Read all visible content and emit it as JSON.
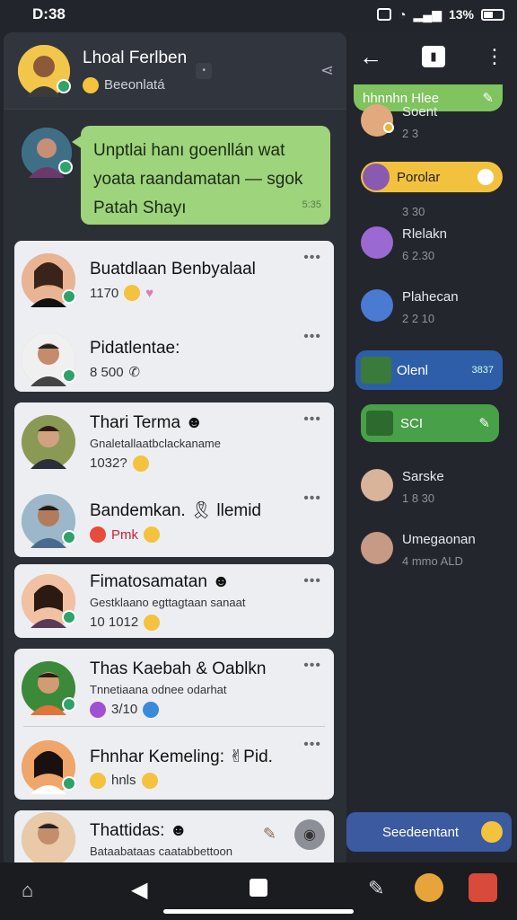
{
  "status_bar": {
    "time": "D:38",
    "battery": "13%"
  },
  "chat_header": {
    "title": "Lhoal Ferlben",
    "subtitle": "Beeonlatá"
  },
  "pinned_message": {
    "lines": [
      "Unptlai hanı goenllán wat",
      "yoata raandamatan — sgok",
      "Patah Shayı"
    ],
    "time": "5:35"
  },
  "chats": [
    {
      "title": "Buatdlaan Benbyalaal",
      "meta": "1170"
    },
    {
      "title": "Pidatlentae:",
      "meta": "8 500"
    },
    {
      "title": "Thari Terma",
      "sub": "Gnaletallaatbclackaname",
      "meta": "1032?"
    },
    {
      "title": "Bandemkan.",
      "title2": "llemid",
      "meta": "Pmk"
    },
    {
      "title": "Fimatosamatan",
      "sub": "Gestklaano egttagtaan sanaat",
      "meta": "10 1012"
    },
    {
      "title": "Thas Kaebah & Oablkn",
      "sub": "Tnnetiaana odnee odarhat",
      "meta": "3/10"
    },
    {
      "title": "Fhnhar Kemeling:",
      "title2": "Pid.",
      "meta": "hnls"
    },
    {
      "title": "Thattidas:",
      "sub": "Bataabataas caatabbettoon"
    }
  ],
  "right_panel": {
    "top_pill": "hhnnhn Hlee",
    "items": [
      {
        "name": "Soent",
        "time": "2 3"
      },
      {
        "name": "Porolar",
        "time": "3 30"
      },
      {
        "name": "Rlelakn",
        "time": "6 2.30"
      },
      {
        "name": "Plahecan",
        "time": "2 2 10"
      },
      {
        "name": "Olenl",
        "time": "3837"
      },
      {
        "name": "SCI",
        "time": ""
      },
      {
        "name": "Sarske",
        "time": "1 8 30"
      },
      {
        "name": "Umegaonan",
        "time": "4 mmo ALD"
      }
    ],
    "bottom_pill": "Seedeentant"
  },
  "colors": {
    "accent_green": "#9ed47c",
    "accent_blue": "#2f5ea8"
  }
}
